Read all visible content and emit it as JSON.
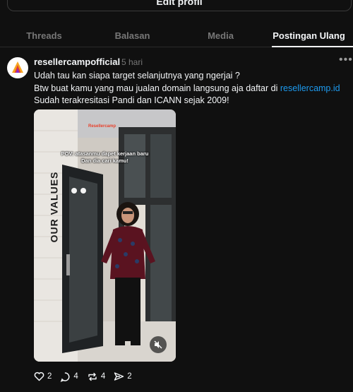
{
  "profile": {
    "edit_label": "Edit profil"
  },
  "tabs": [
    {
      "label": "Threads"
    },
    {
      "label": "Balasan"
    },
    {
      "label": "Media"
    },
    {
      "label": "Postingan Ulang"
    }
  ],
  "post": {
    "username": "resellercampofficial",
    "time": "5 hari",
    "line1": "Udah tau kan siapa target selanjutnya yang ngerjai ?",
    "line2": "Btw buat kamu yang mau jualan domain langsung aja daftar di ",
    "link": "resellercamp.id",
    "line3": "Sudah terakresitasi Pandi dan ICANN sejak 2009!",
    "media": {
      "brand": "Resellercamp",
      "caption_line1": "POV: atasanmu dapet kerjaan baru",
      "caption_line2": "Dan dia cari kamu!",
      "wall_text": "OUR VALUES"
    },
    "stats": {
      "likes": "2",
      "replies": "4",
      "reposts": "4",
      "shares": "2"
    }
  },
  "colors": {
    "background": "#101010",
    "text": "#f3f5f7",
    "muted": "#777777",
    "link": "#1d9bf0"
  }
}
